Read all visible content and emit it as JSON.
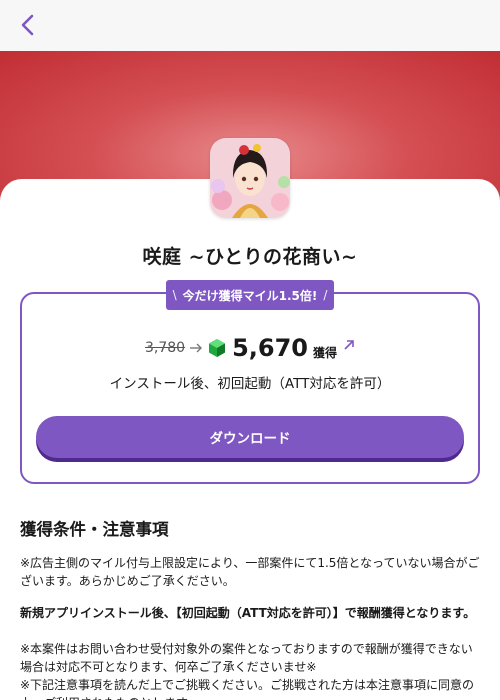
{
  "colors": {
    "accent": "#7e57c2",
    "hero": "#c93a3f"
  },
  "nav": {
    "back_icon": "chevron-left-icon"
  },
  "app": {
    "title": "咲庭 ~ひとりの花商い~",
    "promo_label": "今だけ獲得マイル1.5倍!",
    "promo_slash_left": "\\",
    "promo_slash_right": "/",
    "old_points": "3,780",
    "new_points": "5,670",
    "points_unit": "獲得",
    "condition": "インストール後、初回起動（ATT対応を許可）",
    "download_label": "ダウンロード"
  },
  "notes": {
    "heading": "獲得条件・注意事項",
    "p1": "※広告主側のマイル付与上限設定により、一部案件にて1.5倍となっていない場合がございます。あらかじめご了承ください。",
    "p2": "新規アプリインストール後、【初回起動（ATT対応を許可）】で報酬獲得となります。",
    "p3": "※本案件はお問い合わせ受付対象外の案件となっておりますので報酬が獲得できない場合は対応不可となります、何卒ご了承くださいませ※",
    "p4": "※下記注意事項を読んだ上でご挑戦ください。ご挑戦された方は本注意事項に同意の上、ご利用されたものとします。"
  }
}
